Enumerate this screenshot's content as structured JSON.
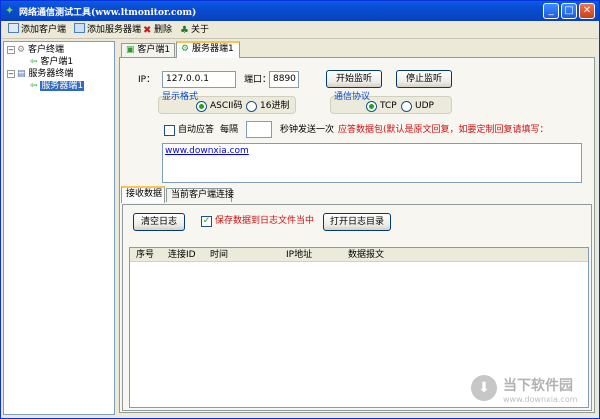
{
  "window": {
    "title": "网络通信测试工具(www.ltmonitor.com)",
    "icon": "app-icon",
    "controls": {
      "minimize": "_",
      "maximize": "□",
      "close": "✕"
    }
  },
  "toolbar": {
    "add_client": "添加客户端",
    "add_server": "添加服务器端",
    "delete": "删除",
    "about": "关于"
  },
  "tree": {
    "client_root": "客户终端",
    "client_child": "客户端1",
    "server_root": "服务器终端",
    "server_child": "服务器端1"
  },
  "tabs": [
    "客户端1",
    "服务器端1"
  ],
  "server_form": {
    "ip_label": "IP：",
    "ip_value": "127.0.0.1",
    "port_label": "端口：",
    "port_value": "8890",
    "start_listen": "开始监听",
    "stop_listen": "停止监听",
    "display_format_title": "显示格式",
    "ascii_label": "ASCII码",
    "hex_label": "16进制",
    "protocol_title": "通信协议",
    "tcp_label": "TCP",
    "udp_label": "UDP",
    "auto_reply_label": "自动应答",
    "every_label": "每隔",
    "interval_value": "",
    "send_once_label": "秒钟发送一次",
    "reply_note": "应答数据包(默认是原文回复，如要定制回复请填写：",
    "reply_text": "www.downxia.com"
  },
  "subtabs": [
    "接收数据",
    "当前客户端连接"
  ],
  "receive": {
    "clear_log": "清空日志",
    "save_to_log_label": "保存数据到日志文件当中",
    "open_log_dir": "打开日志目录",
    "columns": [
      "序号",
      "连接ID",
      "时间",
      "IP地址",
      "数据报文"
    ]
  },
  "watermark": {
    "text": "当下软件园",
    "sub": "www.downxia.com"
  }
}
